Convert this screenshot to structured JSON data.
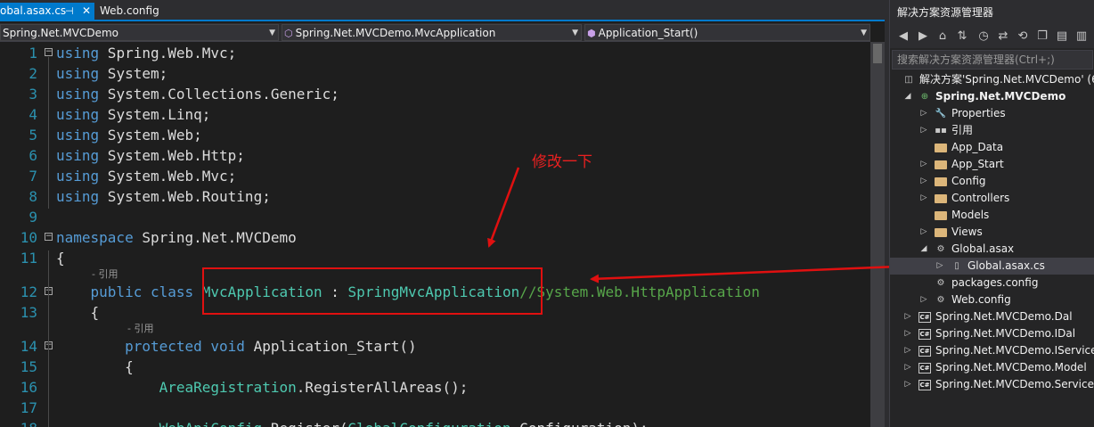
{
  "tabs": {
    "active_label": "obal.asax.cs",
    "pin_icon": "pin-icon",
    "close_icon": "close-icon",
    "other_label": "Web.config"
  },
  "nav": {
    "project": "Spring.Net.MVCDemo",
    "class": "Spring.Net.MVCDemo.MvcApplication",
    "member": "Application_Start()"
  },
  "code": {
    "lines": [
      {
        "n": "1",
        "segments": [
          [
            "kw",
            "using"
          ],
          [
            "pl",
            " Spring.Web.Mvc;"
          ]
        ]
      },
      {
        "n": "2",
        "segments": [
          [
            "kw",
            "using"
          ],
          [
            "pl",
            " System;"
          ]
        ]
      },
      {
        "n": "3",
        "segments": [
          [
            "kw",
            "using"
          ],
          [
            "pl",
            " System.Collections.Generic;"
          ]
        ]
      },
      {
        "n": "4",
        "segments": [
          [
            "kw",
            "using"
          ],
          [
            "pl",
            " System.Linq;"
          ]
        ]
      },
      {
        "n": "5",
        "segments": [
          [
            "kw",
            "using"
          ],
          [
            "pl",
            " System.Web;"
          ]
        ]
      },
      {
        "n": "6",
        "segments": [
          [
            "kw",
            "using"
          ],
          [
            "pl",
            " System.Web.Http;"
          ]
        ]
      },
      {
        "n": "7",
        "segments": [
          [
            "kw",
            "using"
          ],
          [
            "pl",
            " System.Web.Mvc;"
          ]
        ]
      },
      {
        "n": "8",
        "segments": [
          [
            "kw",
            "using"
          ],
          [
            "pl",
            " System.Web.Routing;"
          ]
        ]
      },
      {
        "n": "9",
        "segments": []
      },
      {
        "n": "10",
        "segments": [
          [
            "kw",
            "namespace"
          ],
          [
            "pl",
            " Spring.Net.MVCDemo"
          ]
        ]
      },
      {
        "n": "11",
        "segments": [
          [
            "pl",
            "{"
          ]
        ]
      },
      {
        "n": "12",
        "segments": [
          [
            "pl",
            "    "
          ],
          [
            "kw",
            "public"
          ],
          [
            "pl",
            " "
          ],
          [
            "kw",
            "class"
          ],
          [
            "pl",
            " "
          ],
          [
            "ty",
            "MvcApplication"
          ],
          [
            "pl",
            " : "
          ],
          [
            "ty",
            "SpringMvcApplication"
          ],
          [
            "cm",
            "//System.Web.HttpApplication"
          ]
        ]
      },
      {
        "n": "13",
        "segments": [
          [
            "pl",
            "    {"
          ]
        ]
      },
      {
        "n": "14",
        "segments": [
          [
            "pl",
            "        "
          ],
          [
            "kw",
            "protected"
          ],
          [
            "pl",
            " "
          ],
          [
            "kw",
            "void"
          ],
          [
            "pl",
            " Application_Start()"
          ]
        ]
      },
      {
        "n": "15",
        "segments": [
          [
            "pl",
            "        {"
          ]
        ]
      },
      {
        "n": "16",
        "segments": [
          [
            "pl",
            "            "
          ],
          [
            "ty",
            "AreaRegistration"
          ],
          [
            "pl",
            ".RegisterAllAreas();"
          ]
        ]
      },
      {
        "n": "17",
        "segments": []
      },
      {
        "n": "18",
        "segments": [
          [
            "pl",
            "            "
          ],
          [
            "ty",
            "WebApiConfig"
          ],
          [
            "pl",
            ".Register("
          ],
          [
            "ty",
            "GlobalConfiguration"
          ],
          [
            "pl",
            ".Configuration);"
          ]
        ]
      }
    ],
    "codelens_class": "- 引用",
    "codelens_method": "- 引用"
  },
  "annotation": {
    "label": "修改一下"
  },
  "solution_explorer": {
    "title": "解决方案资源管理器",
    "search_placeholder": "搜索解决方案资源管理器(Ctrl+;)",
    "toolbar_icons": [
      "back-icon",
      "forward-icon",
      "home-icon",
      "sync-icon",
      "history-icon",
      "refresh-icon",
      "collapse-icon",
      "copy-icon",
      "properties-icon"
    ],
    "items": [
      {
        "label": "解决方案'Spring.Net.MVCDemo' (6",
        "indent": 0,
        "expander": "none",
        "icon": "solution-icon",
        "bold": false
      },
      {
        "label": "Spring.Net.MVCDemo",
        "indent": 1,
        "expander": "expanded",
        "icon": "web-project-icon",
        "bold": true
      },
      {
        "label": "Properties",
        "indent": 2,
        "expander": "collapsed",
        "icon": "wrench-icon",
        "bold": false
      },
      {
        "label": "引用",
        "indent": 2,
        "expander": "collapsed",
        "icon": "references-icon",
        "bold": false
      },
      {
        "label": "App_Data",
        "indent": 2,
        "expander": "none",
        "icon": "folder-icon",
        "bold": false
      },
      {
        "label": "App_Start",
        "indent": 2,
        "expander": "collapsed",
        "icon": "folder-icon",
        "bold": false
      },
      {
        "label": "Config",
        "indent": 2,
        "expander": "collapsed",
        "icon": "folder-icon",
        "bold": false
      },
      {
        "label": "Controllers",
        "indent": 2,
        "expander": "collapsed",
        "icon": "folder-icon",
        "bold": false
      },
      {
        "label": "Models",
        "indent": 2,
        "expander": "none",
        "icon": "folder-icon",
        "bold": false
      },
      {
        "label": "Views",
        "indent": 2,
        "expander": "collapsed",
        "icon": "folder-icon",
        "bold": false
      },
      {
        "label": "Global.asax",
        "indent": 2,
        "expander": "expanded",
        "icon": "config-file-icon",
        "bold": false
      },
      {
        "label": "Global.asax.cs",
        "indent": 3,
        "expander": "collapsed",
        "icon": "cs-file-icon",
        "bold": false
      },
      {
        "label": "packages.config",
        "indent": 2,
        "expander": "none",
        "icon": "config-file-icon",
        "bold": false
      },
      {
        "label": "Web.config",
        "indent": 2,
        "expander": "collapsed",
        "icon": "config-file-icon",
        "bold": false
      },
      {
        "label": "Spring.Net.MVCDemo.Dal",
        "indent": 1,
        "expander": "collapsed",
        "icon": "cs-project-icon",
        "bold": false
      },
      {
        "label": "Spring.Net.MVCDemo.IDal",
        "indent": 1,
        "expander": "collapsed",
        "icon": "cs-project-icon",
        "bold": false
      },
      {
        "label": "Spring.Net.MVCDemo.IService",
        "indent": 1,
        "expander": "collapsed",
        "icon": "cs-project-icon",
        "bold": false
      },
      {
        "label": "Spring.Net.MVCDemo.Model",
        "indent": 1,
        "expander": "collapsed",
        "icon": "cs-project-icon",
        "bold": false
      },
      {
        "label": "Spring.Net.MVCDemo.Service",
        "indent": 1,
        "expander": "collapsed",
        "icon": "cs-project-icon",
        "bold": false
      }
    ],
    "cs_badge": "C#"
  },
  "colors": {
    "accent": "#007acc",
    "annotation": "#e01010",
    "keyword": "#569cd6",
    "type": "#4ec9b0",
    "comment": "#57a64a"
  }
}
